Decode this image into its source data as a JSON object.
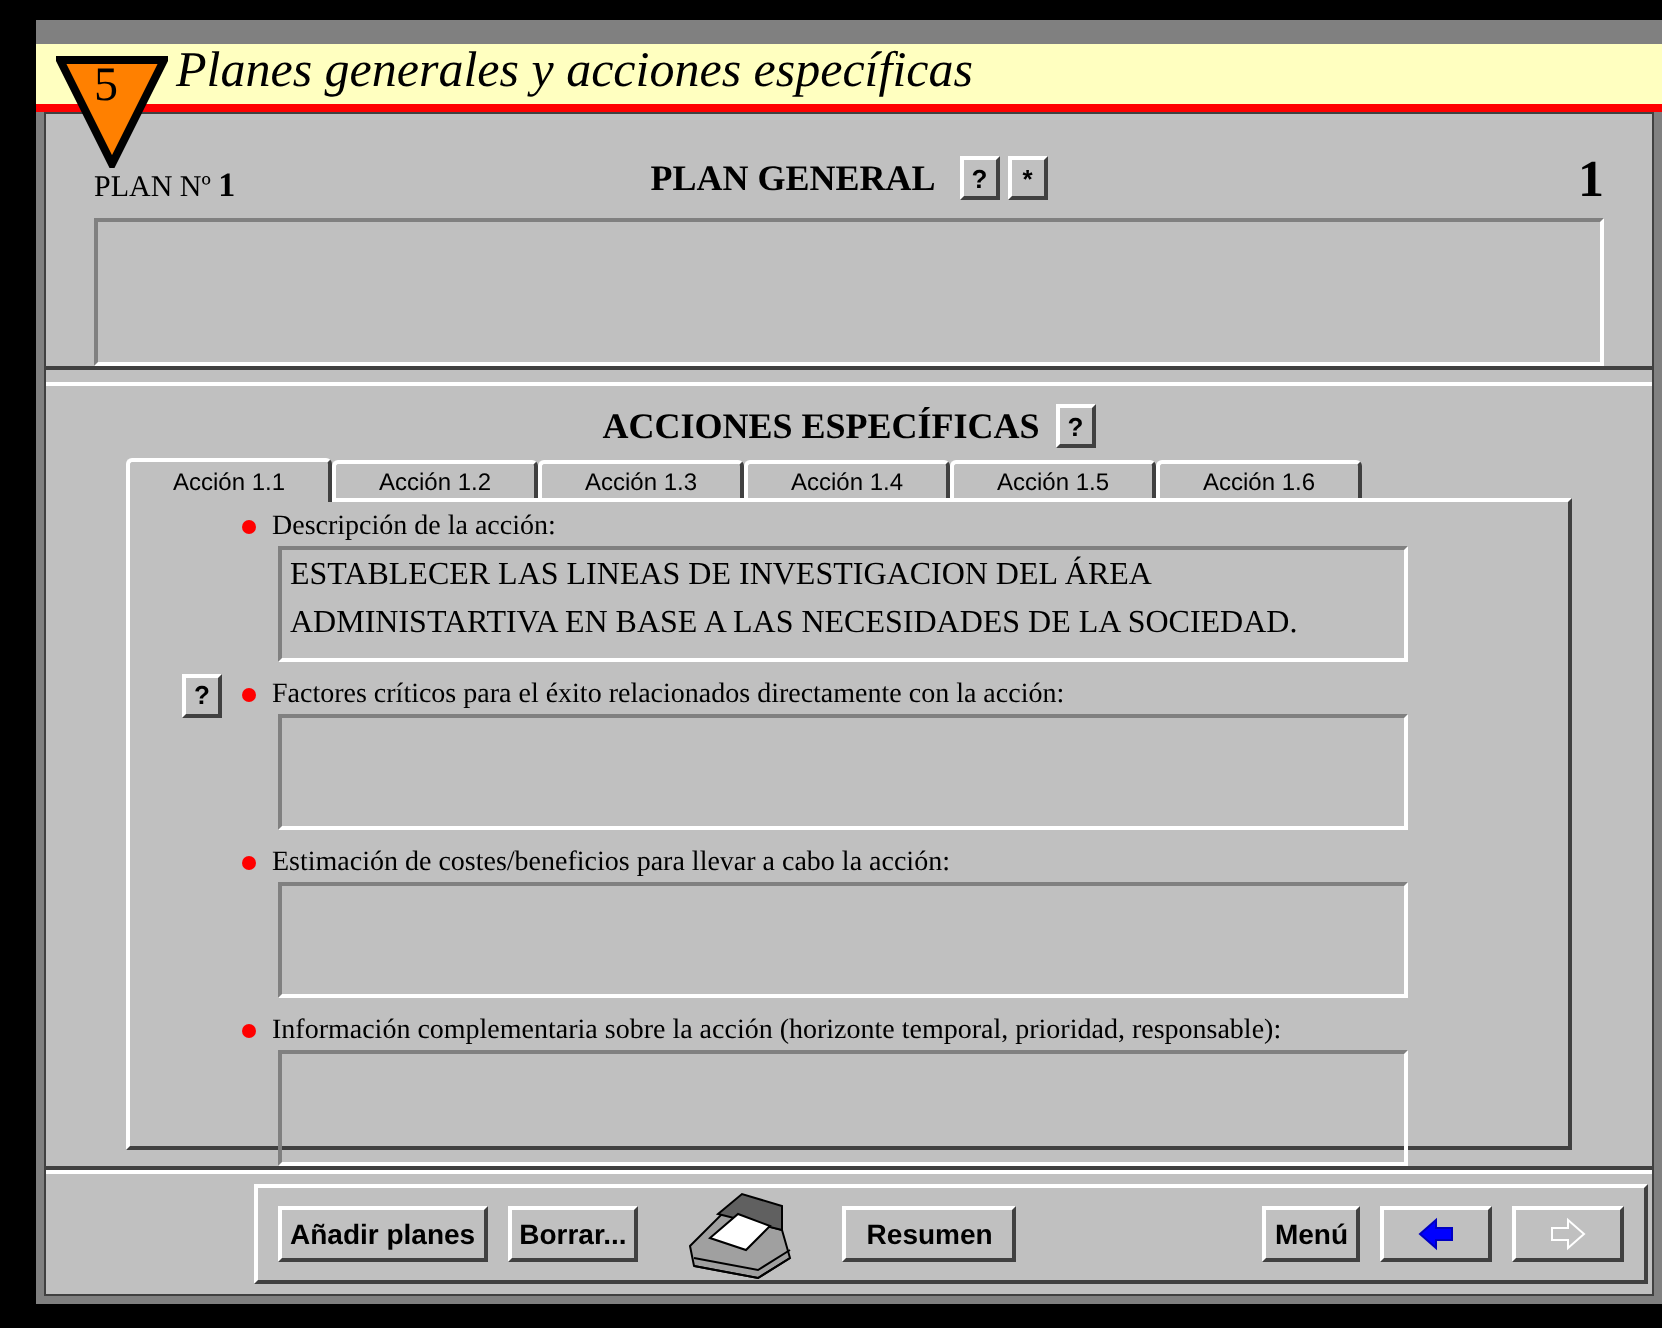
{
  "window": {
    "title": "Planes generales y acciones específicas",
    "step_badge": "5"
  },
  "plan": {
    "label": "PLAN Nº",
    "number": "1",
    "heading": "PLAN GENERAL",
    "help_button": "?",
    "star_button": "*",
    "counter": "1"
  },
  "actions": {
    "heading": "ACCIONES ESPECÍFICAS",
    "help_button": "?",
    "tabs": [
      {
        "label": "Acción 1.1",
        "selected": true
      },
      {
        "label": "Acción 1.2",
        "selected": false
      },
      {
        "label": "Acción 1.3",
        "selected": false
      },
      {
        "label": "Acción 1.4",
        "selected": false
      },
      {
        "label": "Acción 1.5",
        "selected": false
      },
      {
        "label": "Acción 1.6",
        "selected": false
      }
    ],
    "fields": [
      {
        "label": "Descripción de la acción:",
        "value": "ESTABLECER LAS LINEAS DE INVESTIGACION DEL ÁREA ADMINISTARTIVA EN BASE A LAS NECESIDADES DE LA SOCIEDAD."
      },
      {
        "label": "Factores críticos para el éxito relacionados directamente con la acción:",
        "help_button": "?"
      },
      {
        "label": "Estimación de costes/beneficios para llevar a cabo la acción:"
      },
      {
        "label": "Información complementaria sobre la acción (horizonte temporal, prioridad, responsable):"
      }
    ]
  },
  "toolbar": {
    "left": [
      "Añadir planes",
      "Borrar..."
    ],
    "middle": "Resumen",
    "menu": "Menú",
    "back_disabled": false,
    "forward_disabled": true
  }
}
